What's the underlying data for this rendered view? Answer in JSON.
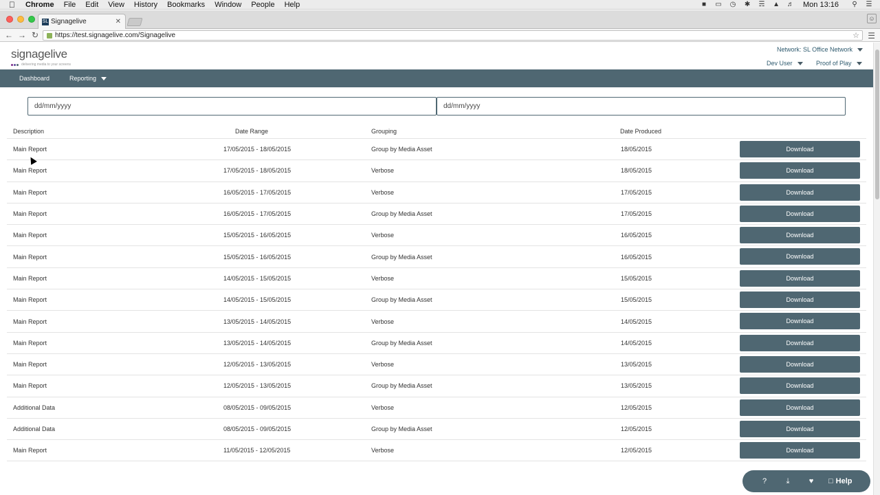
{
  "menubar": {
    "app": "Chrome",
    "items": [
      "File",
      "Edit",
      "View",
      "History",
      "Bookmarks",
      "Window",
      "People",
      "Help"
    ],
    "clock": "Mon 13:16"
  },
  "browser": {
    "tab_title": "Signagelive",
    "tab_favicon": "SL",
    "url": "https://test.signagelive.com/Signagelive"
  },
  "header": {
    "logo_text": "signagelive",
    "logo_tagline": "delivering media to your screens",
    "network": "Network: SL Office Network",
    "user": "Dev User",
    "section": "Proof of Play"
  },
  "nav": {
    "dashboard": "Dashboard",
    "reporting": "Reporting"
  },
  "filters": {
    "from_placeholder": "dd/mm/yyyy",
    "to_placeholder": "dd/mm/yyyy"
  },
  "table": {
    "headers": {
      "description": "Description",
      "date_range": "Date Range",
      "grouping": "Grouping",
      "date_produced": "Date Produced"
    },
    "download_label": "Download",
    "rows": [
      {
        "description": "Main Report",
        "date_range": "17/05/2015 - 18/05/2015",
        "grouping": "Group by Media Asset",
        "date_produced": "18/05/2015"
      },
      {
        "description": "Main Report",
        "date_range": "17/05/2015 - 18/05/2015",
        "grouping": "Verbose",
        "date_produced": "18/05/2015"
      },
      {
        "description": "Main Report",
        "date_range": "16/05/2015 - 17/05/2015",
        "grouping": "Verbose",
        "date_produced": "17/05/2015"
      },
      {
        "description": "Main Report",
        "date_range": "16/05/2015 - 17/05/2015",
        "grouping": "Group by Media Asset",
        "date_produced": "17/05/2015"
      },
      {
        "description": "Main Report",
        "date_range": "15/05/2015 - 16/05/2015",
        "grouping": "Verbose",
        "date_produced": "16/05/2015"
      },
      {
        "description": "Main Report",
        "date_range": "15/05/2015 - 16/05/2015",
        "grouping": "Group by Media Asset",
        "date_produced": "16/05/2015"
      },
      {
        "description": "Main Report",
        "date_range": "14/05/2015 - 15/05/2015",
        "grouping": "Verbose",
        "date_produced": "15/05/2015"
      },
      {
        "description": "Main Report",
        "date_range": "14/05/2015 - 15/05/2015",
        "grouping": "Group by Media Asset",
        "date_produced": "15/05/2015"
      },
      {
        "description": "Main Report",
        "date_range": "13/05/2015 - 14/05/2015",
        "grouping": "Verbose",
        "date_produced": "14/05/2015"
      },
      {
        "description": "Main Report",
        "date_range": "13/05/2015 - 14/05/2015",
        "grouping": "Group by Media Asset",
        "date_produced": "14/05/2015"
      },
      {
        "description": "Main Report",
        "date_range": "12/05/2015 - 13/05/2015",
        "grouping": "Verbose",
        "date_produced": "13/05/2015"
      },
      {
        "description": "Main Report",
        "date_range": "12/05/2015 - 13/05/2015",
        "grouping": "Group by Media Asset",
        "date_produced": "13/05/2015"
      },
      {
        "description": "Additional Data",
        "date_range": "08/05/2015 - 09/05/2015",
        "grouping": "Verbose",
        "date_produced": "12/05/2015"
      },
      {
        "description": "Additional Data",
        "date_range": "08/05/2015 - 09/05/2015",
        "grouping": "Group by Media Asset",
        "date_produced": "12/05/2015"
      },
      {
        "description": "Main Report",
        "date_range": "11/05/2015 - 12/05/2015",
        "grouping": "Verbose",
        "date_produced": "12/05/2015"
      }
    ]
  },
  "help_widget": {
    "icons": [
      "question-icon",
      "download-icon",
      "heart-icon",
      "chat-icon"
    ],
    "help_label": "Help"
  },
  "colors": {
    "brand": "#4f6772",
    "link": "#2e5a6e"
  }
}
